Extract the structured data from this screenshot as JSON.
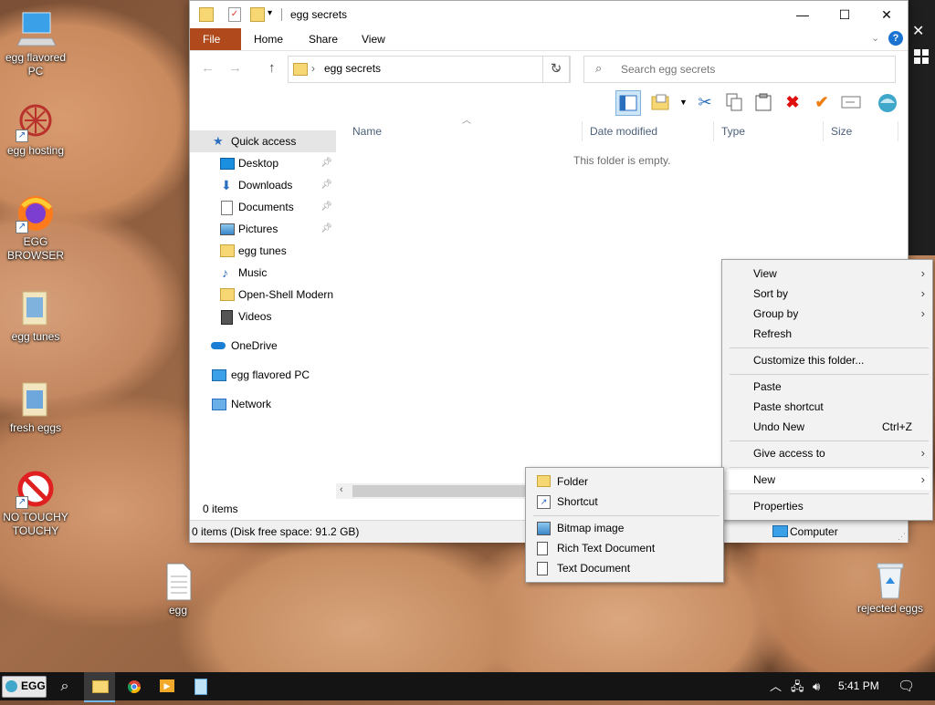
{
  "desktop": {
    "icons": [
      {
        "label": "egg flavored PC"
      },
      {
        "label": "egg hosting"
      },
      {
        "label": "EGG BROWSER"
      },
      {
        "label": "egg tunes"
      },
      {
        "label": "fresh eggs"
      },
      {
        "label": "NO TOUCHY TOUCHY"
      },
      {
        "label": "egg"
      },
      {
        "label": "rejected eggs"
      }
    ]
  },
  "explorer": {
    "title": "egg secrets",
    "tabs": {
      "file": "File",
      "home": "Home",
      "share": "Share",
      "view": "View"
    },
    "address": {
      "path": "egg secrets"
    },
    "search": {
      "placeholder": "Search egg secrets"
    },
    "nav": {
      "quick_access": "Quick access",
      "desktop": "Desktop",
      "downloads": "Downloads",
      "documents": "Documents",
      "pictures": "Pictures",
      "egg_tunes": "egg tunes",
      "music": "Music",
      "open_shell": "Open-Shell Modern",
      "videos": "Videos",
      "onedrive": "OneDrive",
      "this_pc": "egg flavored PC",
      "network": "Network"
    },
    "columns": {
      "name": "Name",
      "date": "Date modified",
      "type": "Type",
      "size": "Size"
    },
    "empty_text": "This folder is empty.",
    "status": "0 items",
    "details_bar": "0 items (Disk free space: 91.2 GB)",
    "details_location": "Computer"
  },
  "context_menu": {
    "view": "View",
    "sort_by": "Sort by",
    "group_by": "Group by",
    "refresh": "Refresh",
    "customize": "Customize this folder...",
    "paste": "Paste",
    "paste_shortcut": "Paste shortcut",
    "undo_new": "Undo New",
    "undo_shortcut": "Ctrl+Z",
    "give_access": "Give access to",
    "new": "New",
    "properties": "Properties"
  },
  "new_submenu": {
    "folder": "Folder",
    "shortcut": "Shortcut",
    "bitmap": "Bitmap image",
    "rtf": "Rich Text Document",
    "text": "Text Document"
  },
  "taskbar": {
    "start_label": "EGG",
    "time": "5:41 PM"
  },
  "colors": {
    "file_tab": "#b04a1d",
    "accent": "#0078d7",
    "folder": "#f7d774"
  }
}
